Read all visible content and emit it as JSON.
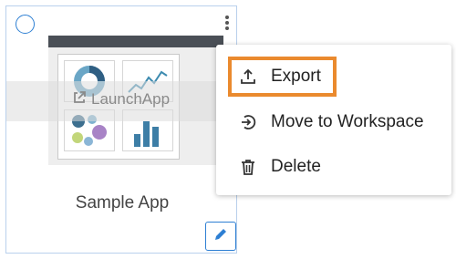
{
  "card": {
    "title": "Sample App",
    "launch_label": "LaunchApp",
    "launch_icon": "external-link-icon",
    "edit_icon": "pencil-icon",
    "accent_color": "#2d7fd3"
  },
  "menu": {
    "items": [
      {
        "label": "Export",
        "icon": "upload-icon"
      },
      {
        "label": "Move to Workspace",
        "icon": "arrow-circle-right-icon"
      },
      {
        "label": "Delete",
        "icon": "trash-icon"
      }
    ],
    "highlight_color": "#ea8a2e"
  }
}
